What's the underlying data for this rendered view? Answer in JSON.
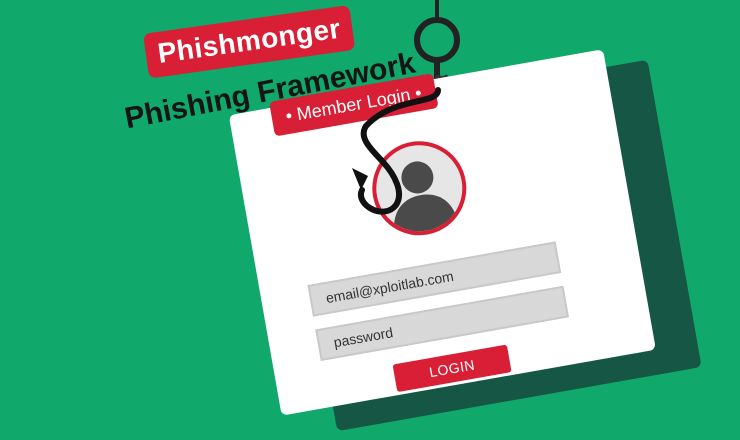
{
  "brand": {
    "title": "Phishmonger",
    "subtitle": "Phishing Framework"
  },
  "card": {
    "member_login": "• Member Login •"
  },
  "form": {
    "email": "email@xploitlab.com",
    "password": "password",
    "login": "LOGIN"
  },
  "colors": {
    "background": "#10a86b",
    "accent": "#d81f35",
    "shadow": "#155744"
  }
}
